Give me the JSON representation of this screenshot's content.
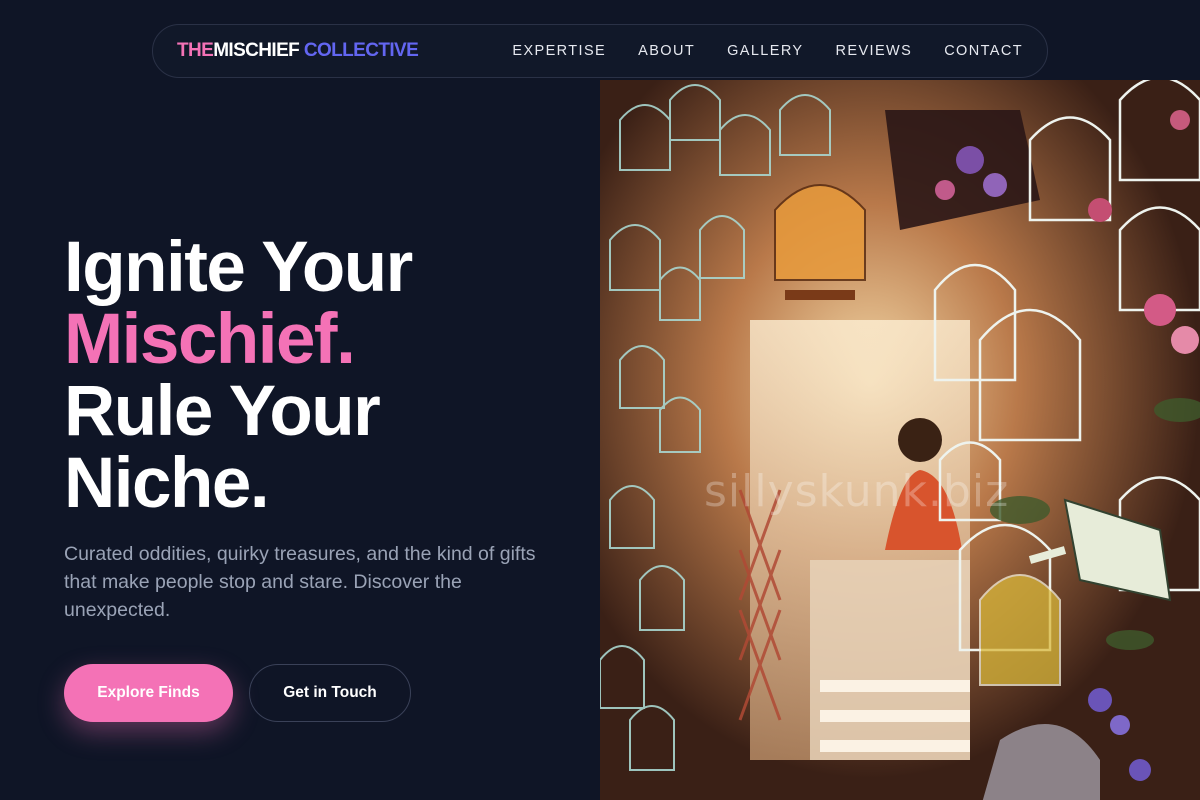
{
  "brand": {
    "part1": "THE",
    "part2": "MISCHIEF",
    "part3": " COLLECTIVE",
    "colors": {
      "pink": "#f472b6",
      "indigo": "#6366f1",
      "background": "#0f1526"
    }
  },
  "nav": {
    "items": [
      {
        "label": "EXPERTISE"
      },
      {
        "label": "ABOUT"
      },
      {
        "label": "GALLERY"
      },
      {
        "label": "REVIEWS"
      },
      {
        "label": "CONTACT"
      }
    ]
  },
  "hero": {
    "line1": "Ignite Your",
    "line2": "Mischief.",
    "line3": "Rule Your",
    "line4": "Niche.",
    "subtitle": "Curated oddities, quirky treasures, and the kind of gifts that make people stop and stare. Discover the unexpected.",
    "primary_cta": "Explore Finds",
    "secondary_cta": "Get in Touch"
  },
  "photo": {
    "watermark": "sillyskunk.biz"
  }
}
